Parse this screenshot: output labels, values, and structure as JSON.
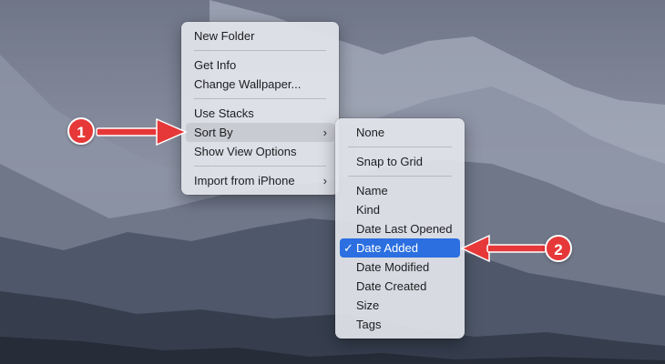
{
  "colors": {
    "accent": "#2b6fe0",
    "badge": "#e63838",
    "arrow": "#e63838"
  },
  "context_menu": {
    "items": [
      {
        "label": "New Folder"
      },
      {
        "label": "Get Info"
      },
      {
        "label": "Change Wallpaper..."
      },
      {
        "label": "Use Stacks"
      },
      {
        "label": "Sort By",
        "submenu_icon": "chevron-right-icon"
      },
      {
        "label": "Show View Options"
      },
      {
        "label": "Import from iPhone",
        "submenu_icon": "chevron-right-icon"
      }
    ]
  },
  "sort_by_menu": {
    "items": [
      {
        "label": "None"
      },
      {
        "label": "Snap to Grid"
      },
      {
        "label": "Name"
      },
      {
        "label": "Kind"
      },
      {
        "label": "Date Last Opened"
      },
      {
        "label": "Date Added",
        "checked": true
      },
      {
        "label": "Date Modified"
      },
      {
        "label": "Date Created"
      },
      {
        "label": "Size"
      },
      {
        "label": "Tags"
      }
    ]
  },
  "annotations": {
    "badge_1": "1",
    "badge_2": "2"
  },
  "glyphs": {
    "chevron": "›",
    "check": "✓"
  }
}
